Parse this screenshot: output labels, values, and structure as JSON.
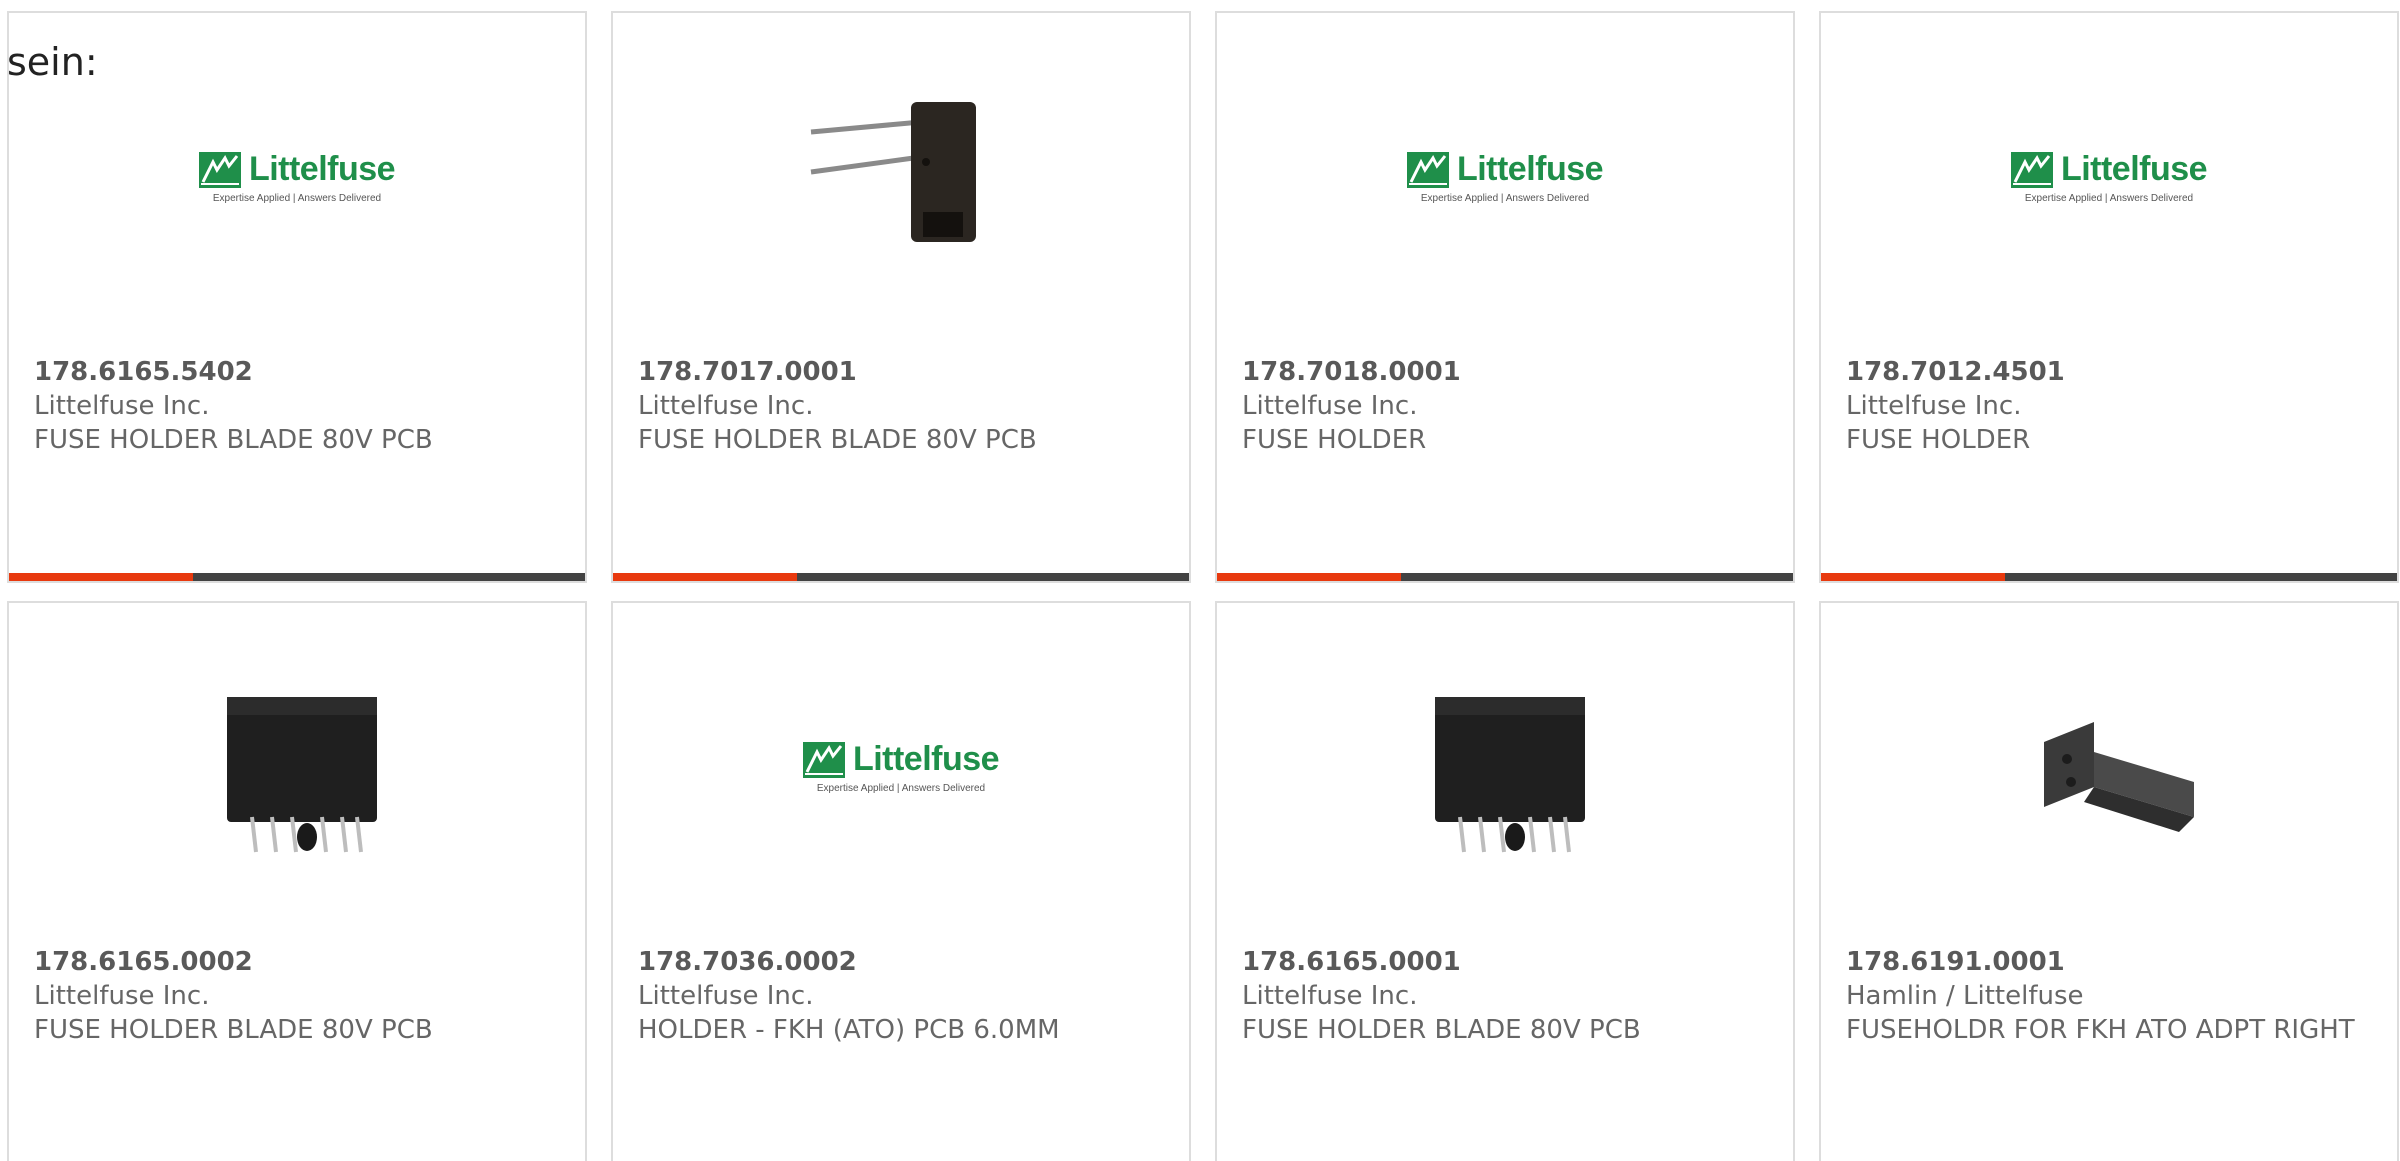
{
  "intro_text": "sein:",
  "accent_color": "#e8390e",
  "bar_color": "#424242",
  "logo": {
    "word": "Littelfuse",
    "tagline": "Expertise Applied | Answers Delivered"
  },
  "products": [
    {
      "part_number": "178.6165.5402",
      "manufacturer": "Littelfuse Inc.",
      "description": "FUSE HOLDER BLADE 80V PCB",
      "image": "littelfuse-logo",
      "progress": 0.32
    },
    {
      "part_number": "178.7017.0001",
      "manufacturer": "Littelfuse Inc.",
      "description": "FUSE HOLDER BLADE 80V PCB",
      "image": "fuse-holder-wired-photo",
      "progress": 0.32
    },
    {
      "part_number": "178.7018.0001",
      "manufacturer": "Littelfuse Inc.",
      "description": "FUSE HOLDER",
      "image": "littelfuse-logo",
      "progress": 0.32
    },
    {
      "part_number": "178.7012.4501",
      "manufacturer": "Littelfuse Inc.",
      "description": "FUSE HOLDER",
      "image": "littelfuse-logo",
      "progress": 0.32
    },
    {
      "part_number": "178.6165.0002",
      "manufacturer": "Littelfuse Inc.",
      "description": "FUSE HOLDER BLADE 80V PCB",
      "image": "fuse-holder-block-photo"
    },
    {
      "part_number": "178.7036.0002",
      "manufacturer": "Littelfuse Inc.",
      "description": "HOLDER - FKH (ATO) PCB 6.0MM",
      "image": "littelfuse-logo"
    },
    {
      "part_number": "178.6165.0001",
      "manufacturer": "Littelfuse Inc.",
      "description": "FUSE HOLDER BLADE 80V PCB",
      "image": "fuse-holder-block-photo"
    },
    {
      "part_number": "178.6191.0001",
      "manufacturer": "Hamlin / Littelfuse",
      "description": "FUSEHOLDR FOR FKH ATO ADPT RIGHT",
      "image": "fuse-holder-adapter-photo"
    }
  ]
}
